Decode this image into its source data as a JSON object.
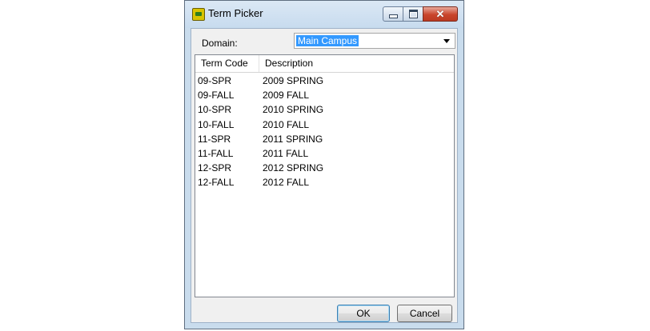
{
  "window": {
    "title": "Term Picker",
    "app_icon": "term-picker-app-icon",
    "caption_buttons": [
      "minimize",
      "maximize",
      "close"
    ]
  },
  "domain": {
    "label": "Domain:",
    "selected": "Main Campus"
  },
  "table": {
    "columns": [
      "Term Code",
      "Description"
    ],
    "rows": [
      {
        "code": "09-SPR",
        "description": "2009 SPRING"
      },
      {
        "code": "09-FALL",
        "description": "2009 FALL"
      },
      {
        "code": "10-SPR",
        "description": "2010 SPRING"
      },
      {
        "code": "10-FALL",
        "description": "2010 FALL"
      },
      {
        "code": "11-SPR",
        "description": "2011 SPRING"
      },
      {
        "code": "11-FALL",
        "description": "2011 FALL"
      },
      {
        "code": "12-SPR",
        "description": "2012 SPRING"
      },
      {
        "code": "12-FALL",
        "description": "2012 FALL"
      }
    ]
  },
  "buttons": {
    "ok": "OK",
    "cancel": "Cancel"
  },
  "colors": {
    "selection": "#3399ff",
    "close_button": "#c9452c",
    "frame": "#c9dced"
  }
}
